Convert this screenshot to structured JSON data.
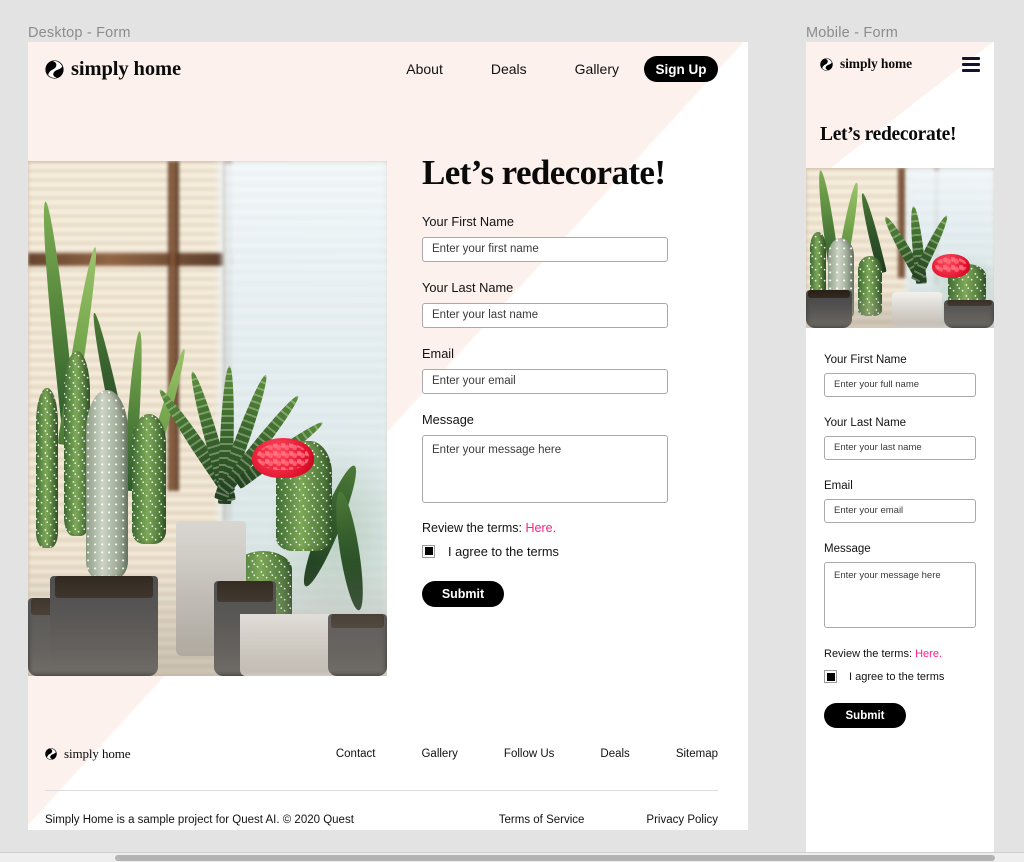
{
  "canvas": {
    "background_color": "#e3e3e3",
    "accent_pink": "#ff1f87",
    "wash_pink": "#fdf1ee",
    "black": "#000000"
  },
  "frames": {
    "desktop_label": "Desktop - Form",
    "mobile_label": "Mobile - Form"
  },
  "brand": {
    "name": "simply home",
    "mark": "yin-yang-circle-logo"
  },
  "desktop": {
    "nav": {
      "items": [
        {
          "label": "About"
        },
        {
          "label": "Deals"
        },
        {
          "label": "Gallery"
        }
      ],
      "cta_label": "Sign Up"
    },
    "hero": {
      "headline": "Let’s redecorate!",
      "photo_alt": "potted cacti and succulents on a sunlit windowsill"
    },
    "form": {
      "fields": [
        {
          "label": "Your First Name",
          "placeholder": "Enter your first name",
          "value": "",
          "type": "text"
        },
        {
          "label": "Your Last Name",
          "placeholder": "Enter your last name",
          "value": "",
          "type": "text"
        },
        {
          "label": "Email",
          "placeholder": "Enter your email",
          "value": "",
          "type": "text"
        },
        {
          "label": "Message",
          "placeholder": "Enter your message here",
          "value": "",
          "type": "textarea"
        }
      ],
      "terms_prefix": "Review the terms:",
      "terms_link_label": "Here.",
      "agree_label": "I agree to the terms",
      "agree_checked": true,
      "submit_label": "Submit"
    },
    "footer": {
      "links": [
        {
          "label": "Contact"
        },
        {
          "label": "Gallery"
        },
        {
          "label": "Follow Us"
        },
        {
          "label": "Deals"
        },
        {
          "label": "Sitemap"
        }
      ],
      "copyright": "Simply Home is a sample project for Quest AI. © 2020 Quest",
      "legal_links": [
        {
          "label": "Terms of Service"
        },
        {
          "label": "Privacy Policy"
        }
      ]
    }
  },
  "mobile": {
    "menu_icon": "hamburger-icon",
    "headline": "Let’s redecorate!",
    "photo_alt": "potted cacti and succulents on a sunlit windowsill",
    "form": {
      "fields": [
        {
          "label": "Your First Name",
          "placeholder": "Enter your full name",
          "value": "",
          "type": "text"
        },
        {
          "label": "Your Last Name",
          "placeholder": "Enter your last name",
          "value": "",
          "type": "text"
        },
        {
          "label": "Email",
          "placeholder": "Enter your email",
          "value": "",
          "type": "text"
        },
        {
          "label": "Message",
          "placeholder": "Enter your message here",
          "type": "textarea",
          "value": ""
        }
      ],
      "terms_prefix": "Review the terms:",
      "terms_link_label": "Here.",
      "agree_label": "I agree to the terms",
      "agree_checked": true,
      "submit_label": "Submit"
    }
  }
}
